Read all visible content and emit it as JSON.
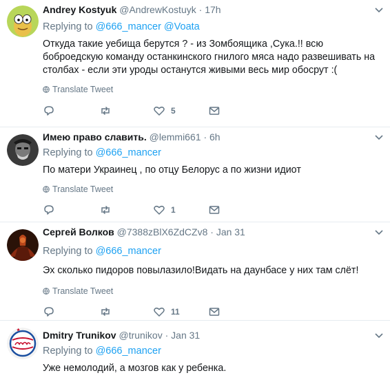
{
  "icons": [
    "reply-icon",
    "retweet-icon",
    "like-icon",
    "dm-icon",
    "chevron-down-icon",
    "globe-icon"
  ],
  "tweets": [
    {
      "name": "Andrey Kostyuk",
      "handle": "@AndrewKostuyk",
      "sep": "·",
      "time": "17h",
      "replying_prefix": "Replying to",
      "replying_to": "@666_mancer @Voata",
      "text": "Откуда такие уебища берутся ? - из Зомбоящика ,Сука.!!  всю боброедскую команду останкинского гнилого мяса надо развешивать на столбах - если эти уроды останутся живыми весь мир обосрут :(",
      "translate": "Translate Tweet",
      "likes": "5"
    },
    {
      "name": "Имею право славить.",
      "handle": "@lemmi661",
      "sep": "·",
      "time": "6h",
      "replying_prefix": "Replying to",
      "replying_to": "@666_mancer",
      "text": "По матери Украинец , по отцу Белорус а по жизни идиот",
      "translate": "Translate Tweet",
      "likes": "1"
    },
    {
      "name": "Сергей Волков",
      "handle": "@7388zBlX6ZdCZv8",
      "sep": "·",
      "time": "Jan 31",
      "replying_prefix": "Replying to",
      "replying_to": "@666_mancer",
      "text": "Эх сколько пидоров повылазило!Видать на даунбасе у них там слёт!",
      "translate": "Translate Tweet",
      "likes": "11"
    },
    {
      "name": "Dmitry Trunikov",
      "handle": "@trunikov",
      "sep": "·",
      "time": "Jan 31",
      "replying_prefix": "Replying to",
      "replying_to": "@666_mancer",
      "text": "Уже немолодий, а мозгов как у ребенка."
    }
  ]
}
